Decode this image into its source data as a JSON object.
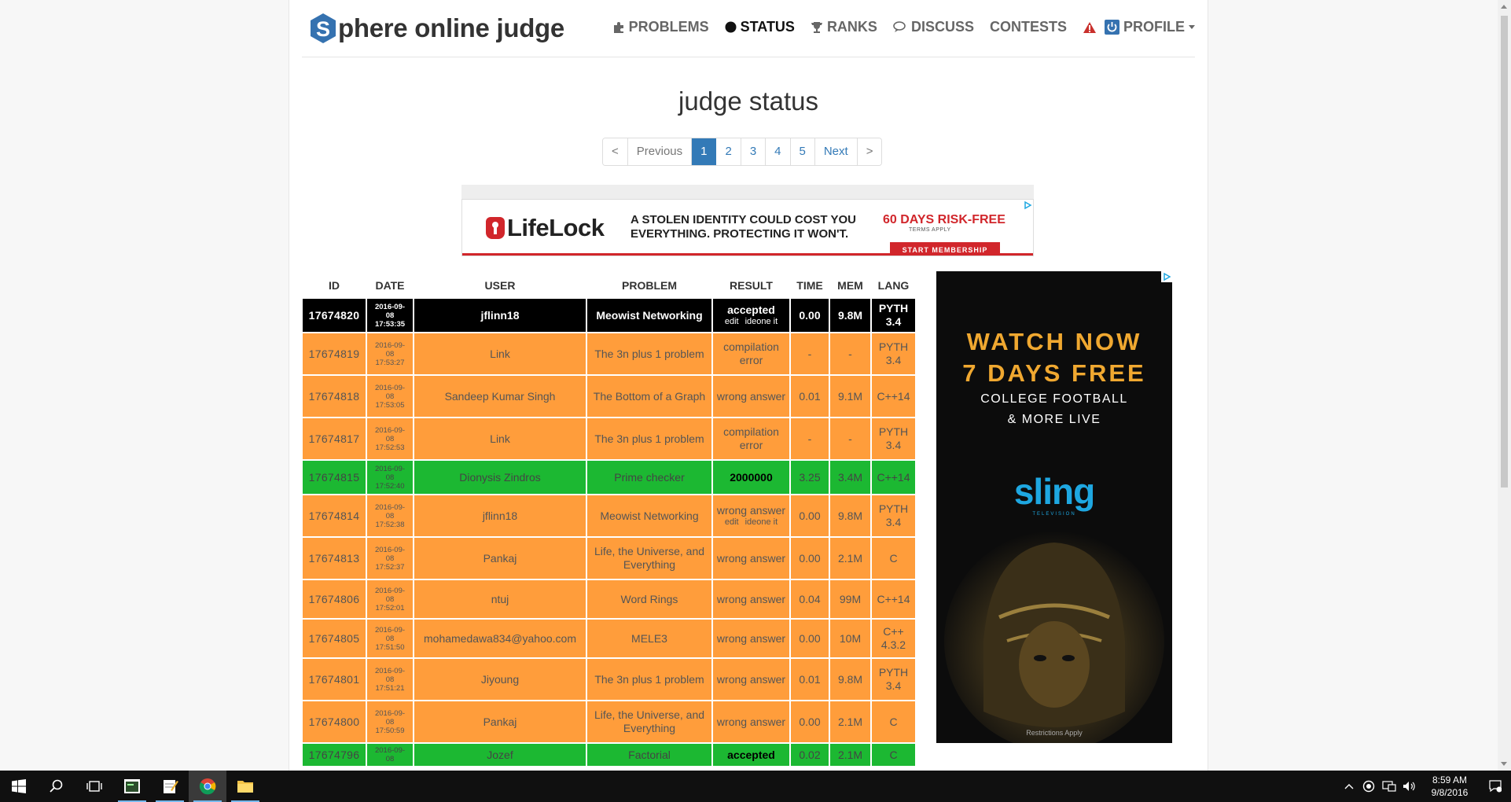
{
  "site": {
    "logo_letter": "S",
    "logo_text": "phere online judge",
    "nav": [
      {
        "label": "PROBLEMS",
        "icon": "puzzle-icon"
      },
      {
        "label": "STATUS",
        "icon": "circle-icon"
      },
      {
        "label": "RANKS",
        "icon": "trophy-icon"
      },
      {
        "label": "DISCUSS",
        "icon": "chat-icon"
      },
      {
        "label": "CONTESTS",
        "icon": ""
      },
      {
        "label": "PROFILE",
        "icon": "power-icon"
      }
    ]
  },
  "page": {
    "title": "judge status"
  },
  "pagination": [
    "<",
    "Previous",
    "1",
    "2",
    "3",
    "4",
    "5",
    "Next",
    ">"
  ],
  "ad_top": {
    "brand": "LifeLock",
    "copy_line1": "A STOLEN IDENTITY COULD COST YOU",
    "copy_line2": "EVERYTHING. PROTECTING IT WON'T.",
    "offer": "60 DAYS RISK-FREE",
    "terms": "TERMS APPLY",
    "button": "START MEMBERSHIP"
  },
  "table": {
    "headers": [
      "ID",
      "DATE",
      "USER",
      "PROBLEM",
      "RESULT",
      "TIME",
      "MEM",
      "LANG"
    ],
    "rows": [
      {
        "id": "17674820",
        "date": [
          "2016-09-",
          "08",
          "17:53:35"
        ],
        "user": "jflinn18",
        "problem": "Meowist Networking",
        "result": "accepted",
        "result_links": [
          "edit",
          "ideone it"
        ],
        "time": "0.00",
        "mem": "9.8M",
        "lang": "PYTH 3.4",
        "style": "black"
      },
      {
        "id": "17674819",
        "date": [
          "2016-09-",
          "08",
          "17:53:27"
        ],
        "user": "Link",
        "problem": "The 3n plus 1 problem",
        "result": "compilation error",
        "result_links": [],
        "time": "-",
        "mem": "-",
        "lang": "PYTH 3.4",
        "style": "orange"
      },
      {
        "id": "17674818",
        "date": [
          "2016-09-",
          "08",
          "17:53:05"
        ],
        "user": "Sandeep Kumar Singh",
        "problem": "The Bottom of a Graph",
        "result": "wrong answer",
        "result_links": [],
        "time": "0.01",
        "mem": "9.1M",
        "lang": "C++14",
        "style": "orange"
      },
      {
        "id": "17674817",
        "date": [
          "2016-09-",
          "08",
          "17:52:53"
        ],
        "user": "Link",
        "problem": "The 3n plus 1 problem",
        "result": "compilation error",
        "result_links": [],
        "time": "-",
        "mem": "-",
        "lang": "PYTH 3.4",
        "style": "orange"
      },
      {
        "id": "17674815",
        "date": [
          "2016-09-",
          "08",
          "17:52:40"
        ],
        "user": "Dionysis Zindros",
        "problem": "Prime checker",
        "result": "2000000",
        "result_links": [],
        "time": "3.25",
        "mem": "3.4M",
        "lang": "C++14",
        "style": "green"
      },
      {
        "id": "17674814",
        "date": [
          "2016-09-",
          "08",
          "17:52:38"
        ],
        "user": "jflinn18",
        "problem": "Meowist Networking",
        "result": "wrong answer",
        "result_links": [
          "edit",
          "ideone it"
        ],
        "time": "0.00",
        "mem": "9.8M",
        "lang": "PYTH 3.4",
        "style": "orange"
      },
      {
        "id": "17674813",
        "date": [
          "2016-09-",
          "08",
          "17:52:37"
        ],
        "user": "Pankaj",
        "problem": "Life, the Universe, and Everything",
        "result": "wrong answer",
        "result_links": [],
        "time": "0.00",
        "mem": "2.1M",
        "lang": "C",
        "style": "orange"
      },
      {
        "id": "17674806",
        "date": [
          "2016-09-",
          "08",
          "17:52:01"
        ],
        "user": "ntuj",
        "problem": "Word Rings",
        "result": "wrong answer",
        "result_links": [],
        "time": "0.04",
        "mem": "99M",
        "lang": "C++14",
        "style": "orange"
      },
      {
        "id": "17674805",
        "date": [
          "2016-09-",
          "08",
          "17:51:50"
        ],
        "user": "mohamedawa834@yahoo.com",
        "problem": "MELE3",
        "result": "wrong answer",
        "result_links": [],
        "time": "0.00",
        "mem": "10M",
        "lang": "C++ 4.3.2",
        "style": "orange"
      },
      {
        "id": "17674801",
        "date": [
          "2016-09-",
          "08",
          "17:51:21"
        ],
        "user": "Jiyoung",
        "problem": "The 3n plus 1 problem",
        "result": "wrong answer",
        "result_links": [],
        "time": "0.01",
        "mem": "9.8M",
        "lang": "PYTH 3.4",
        "style": "orange"
      },
      {
        "id": "17674800",
        "date": [
          "2016-09-",
          "08",
          "17:50:59"
        ],
        "user": "Pankaj",
        "problem": "Life, the Universe, and Everything",
        "result": "wrong answer",
        "result_links": [],
        "time": "0.00",
        "mem": "2.1M",
        "lang": "C",
        "style": "orange"
      },
      {
        "id": "17674796",
        "date": [
          "2016-09-",
          "08",
          ""
        ],
        "user": "Jozef",
        "problem": "Factorial",
        "result": "accepted",
        "result_links": [],
        "time": "0.02",
        "mem": "2.1M",
        "lang": "C",
        "style": "green"
      }
    ]
  },
  "ad_side": {
    "line1": "WATCH NOW",
    "line2": "7 DAYS FREE",
    "line3": "COLLEGE FOOTBALL",
    "line4": "& MORE LIVE",
    "brand": "sling",
    "brand_sub": "TELEVISION",
    "restrictions": "Restrictions Apply"
  },
  "taskbar": {
    "time": "8:59 AM",
    "date": "9/8/2016",
    "apps": [
      "start-icon",
      "search-icon",
      "task-view-icon",
      "terminal-icon",
      "notepad-icon",
      "chrome-icon",
      "folder-icon"
    ]
  },
  "colors": {
    "accent": "#337ab7",
    "row_orange": "#ff9d3b",
    "row_green": "#1cb832",
    "row_black": "#000000",
    "logo_blue": "#3572b0"
  }
}
